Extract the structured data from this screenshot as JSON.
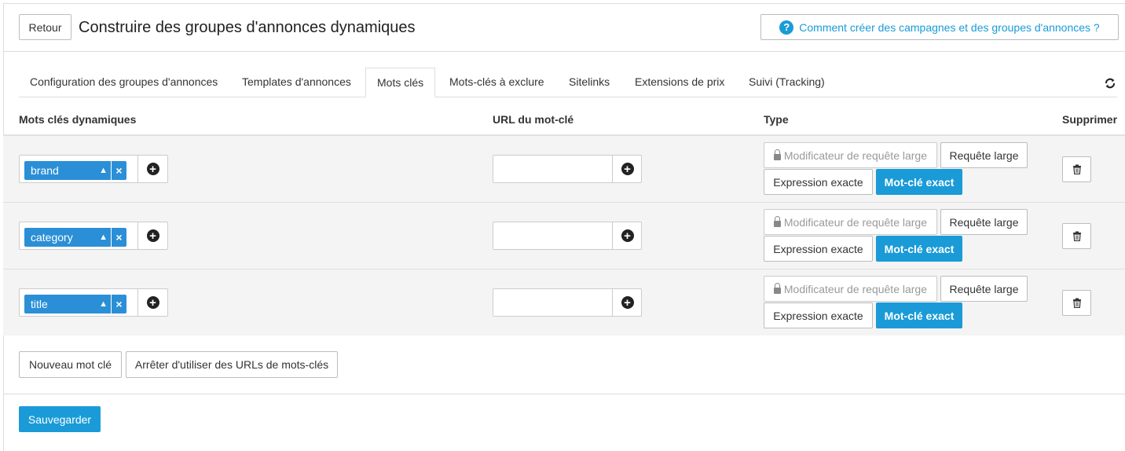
{
  "header": {
    "back_label": "Retour",
    "title": "Construire des groupes d'annonces dynamiques",
    "help_label": "Comment créer des campagnes et des groupes d'annonces ?",
    "help_icon": "question-circle-icon"
  },
  "tabs": [
    {
      "label": "Configuration des groupes d'annonces",
      "active": false
    },
    {
      "label": "Templates d'annonces",
      "active": false
    },
    {
      "label": "Mots clés",
      "active": true
    },
    {
      "label": "Mots-clés à exclure",
      "active": false
    },
    {
      "label": "Sitelinks",
      "active": false
    },
    {
      "label": "Extensions de prix",
      "active": false
    },
    {
      "label": "Suivi (Tracking)",
      "active": false
    }
  ],
  "table": {
    "headers": {
      "keywords": "Mots clés dynamiques",
      "url": "URL du mot-clé",
      "type": "Type",
      "delete": "Supprimer"
    },
    "type_labels": {
      "broad_modifier": "Modificateur de requête large",
      "broad": "Requête large",
      "phrase": "Expression exacte",
      "exact": "Mot-clé exact"
    },
    "rows": [
      {
        "keyword": "brand",
        "url": "",
        "selected_type": "exact"
      },
      {
        "keyword": "category",
        "url": "",
        "selected_type": "exact"
      },
      {
        "keyword": "title",
        "url": "",
        "selected_type": "exact"
      }
    ]
  },
  "actions": {
    "new_keyword": "Nouveau mot clé",
    "stop_urls": "Arrêter d'utiliser des URLs de mots-clés",
    "save": "Sauvegarder"
  },
  "colors": {
    "accent": "#1a9bd7",
    "tag": "#2a8fd6"
  }
}
